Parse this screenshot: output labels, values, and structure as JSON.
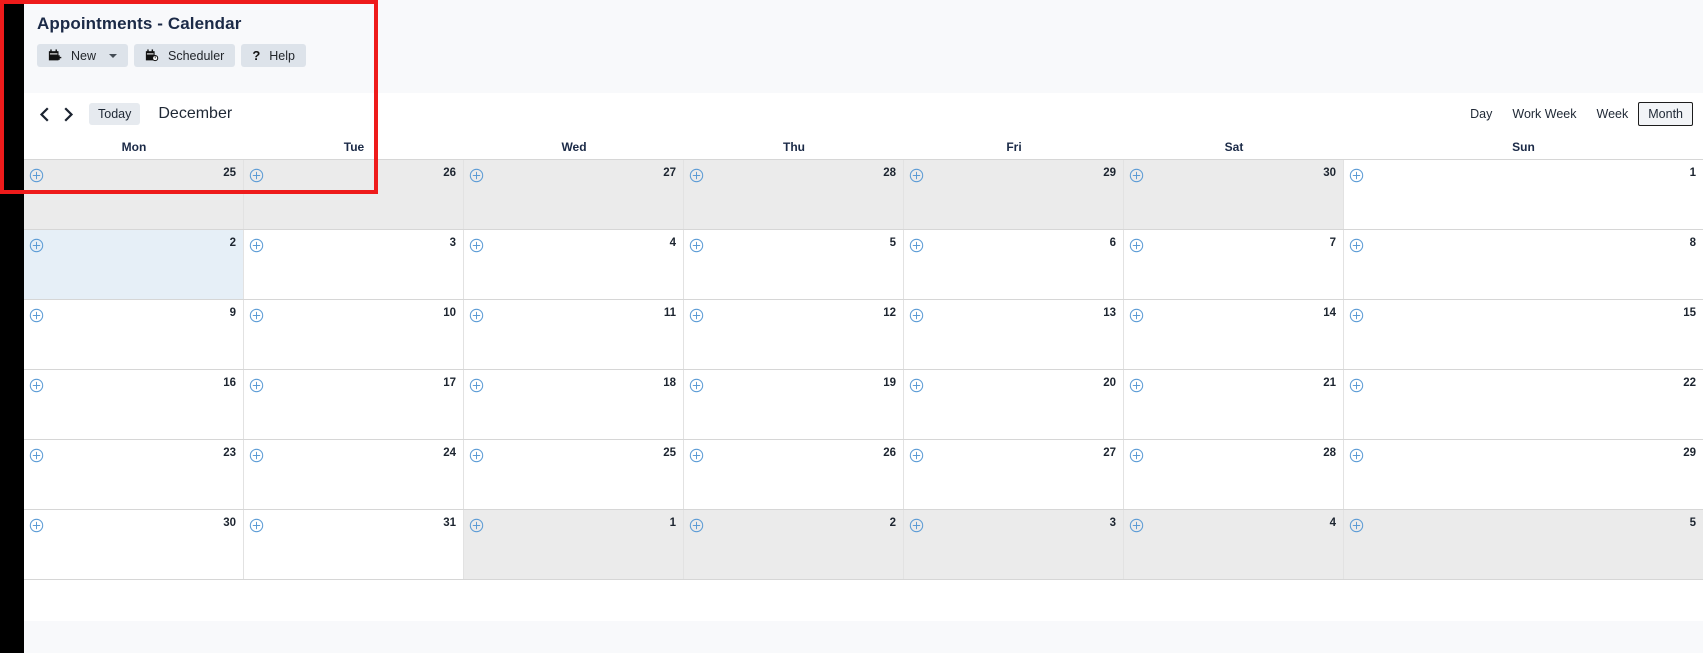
{
  "header": {
    "title": "Appointments - Calendar"
  },
  "toolbar": {
    "new_label": "New",
    "new_icon": "calendar-plus-icon",
    "scheduler_label": "Scheduler",
    "scheduler_icon": "calendar-clock-icon",
    "help_label": "Help",
    "help_icon": "question-mark-icon",
    "dropdown_icon": "caret-down-icon"
  },
  "nav": {
    "prev_icon": "chevron-left-icon",
    "next_icon": "chevron-right-icon",
    "today_label": "Today",
    "current_period": "December"
  },
  "views": {
    "options": [
      "Day",
      "Work Week",
      "Week",
      "Month"
    ],
    "selected": "Month"
  },
  "calendar": {
    "day_headers": [
      "Mon",
      "Tue",
      "Wed",
      "Thu",
      "Fri",
      "Sat",
      "Sun"
    ],
    "add_icon": "circle-plus-icon",
    "weeks": [
      [
        {
          "day": "25",
          "state": "other"
        },
        {
          "day": "26",
          "state": "other"
        },
        {
          "day": "27",
          "state": "other"
        },
        {
          "day": "28",
          "state": "other"
        },
        {
          "day": "29",
          "state": "other"
        },
        {
          "day": "30",
          "state": "other"
        },
        {
          "day": "1",
          "state": "current"
        }
      ],
      [
        {
          "day": "2",
          "state": "today"
        },
        {
          "day": "3",
          "state": "current"
        },
        {
          "day": "4",
          "state": "current"
        },
        {
          "day": "5",
          "state": "current"
        },
        {
          "day": "6",
          "state": "current"
        },
        {
          "day": "7",
          "state": "current"
        },
        {
          "day": "8",
          "state": "current"
        }
      ],
      [
        {
          "day": "9",
          "state": "current"
        },
        {
          "day": "10",
          "state": "current"
        },
        {
          "day": "11",
          "state": "current"
        },
        {
          "day": "12",
          "state": "current"
        },
        {
          "day": "13",
          "state": "current"
        },
        {
          "day": "14",
          "state": "current"
        },
        {
          "day": "15",
          "state": "current"
        }
      ],
      [
        {
          "day": "16",
          "state": "current"
        },
        {
          "day": "17",
          "state": "current"
        },
        {
          "day": "18",
          "state": "current"
        },
        {
          "day": "19",
          "state": "current"
        },
        {
          "day": "20",
          "state": "current"
        },
        {
          "day": "21",
          "state": "current"
        },
        {
          "day": "22",
          "state": "current"
        }
      ],
      [
        {
          "day": "23",
          "state": "current"
        },
        {
          "day": "24",
          "state": "current"
        },
        {
          "day": "25",
          "state": "current"
        },
        {
          "day": "26",
          "state": "current"
        },
        {
          "day": "27",
          "state": "current"
        },
        {
          "day": "28",
          "state": "current"
        },
        {
          "day": "29",
          "state": "current"
        }
      ],
      [
        {
          "day": "30",
          "state": "current"
        },
        {
          "day": "31",
          "state": "current"
        },
        {
          "day": "1",
          "state": "other"
        },
        {
          "day": "2",
          "state": "other"
        },
        {
          "day": "3",
          "state": "other"
        },
        {
          "day": "4",
          "state": "other"
        },
        {
          "day": "5",
          "state": "other"
        }
      ]
    ]
  },
  "annotation": {
    "color": "#ee1b1b",
    "shape": "rectangle-highlight"
  },
  "colors": {
    "title_text": "#1b2a47",
    "toolbar_button_bg": "#dde3ea",
    "today_cell": "#e6eff7",
    "other_month_cell": "#ebebeb",
    "add_icon": "#5b9bd5"
  }
}
